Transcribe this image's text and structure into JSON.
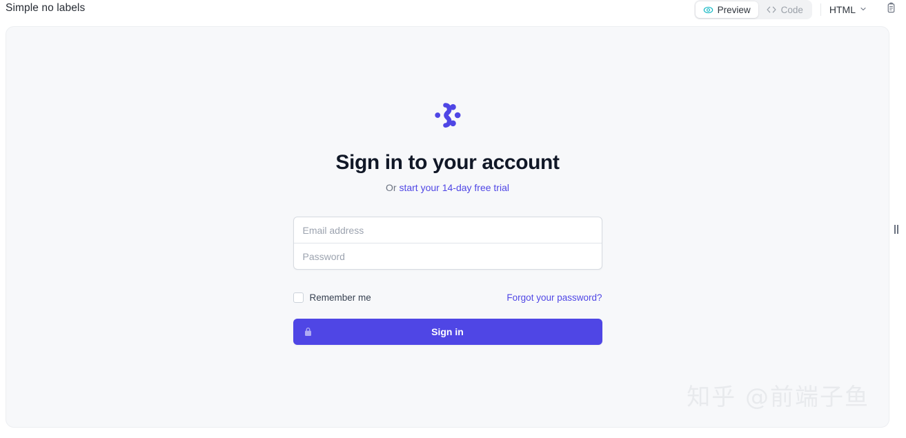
{
  "topbar": {
    "title": "Simple no labels",
    "tabs": [
      {
        "label": "Preview",
        "icon": "eye-icon",
        "active": true
      },
      {
        "label": "Code",
        "icon": "code-brackets-icon",
        "active": false
      }
    ],
    "language_select": {
      "value": "HTML",
      "icon": "chevron-down-icon"
    },
    "copy_button": {
      "icon": "clipboard-icon"
    }
  },
  "preview": {
    "logo": {
      "icon": "molecule-dots-logo",
      "color": "#4f46e5"
    },
    "heading": "Sign in to your account",
    "subtitle_prefix": "Or ",
    "subtitle_link": "start your 14-day free trial",
    "form": {
      "email": {
        "placeholder": "Email address",
        "value": ""
      },
      "password": {
        "placeholder": "Password",
        "value": ""
      },
      "remember_me": {
        "label": "Remember me",
        "checked": false
      },
      "forgot_password_link": "Forgot your password?",
      "submit": {
        "label": "Sign in",
        "icon": "lock-closed-icon",
        "color": "#4f46e5"
      }
    }
  },
  "watermark": {
    "text": "知乎 @前端子鱼"
  },
  "drag_handle": {
    "icon": "resize-grip-icon"
  },
  "colors": {
    "accent": "#4f46e5",
    "heading": "#111827",
    "muted_text": "#6b7280",
    "panel_bg": "#f7f8fa",
    "preview_icon": "#14b8c4"
  }
}
